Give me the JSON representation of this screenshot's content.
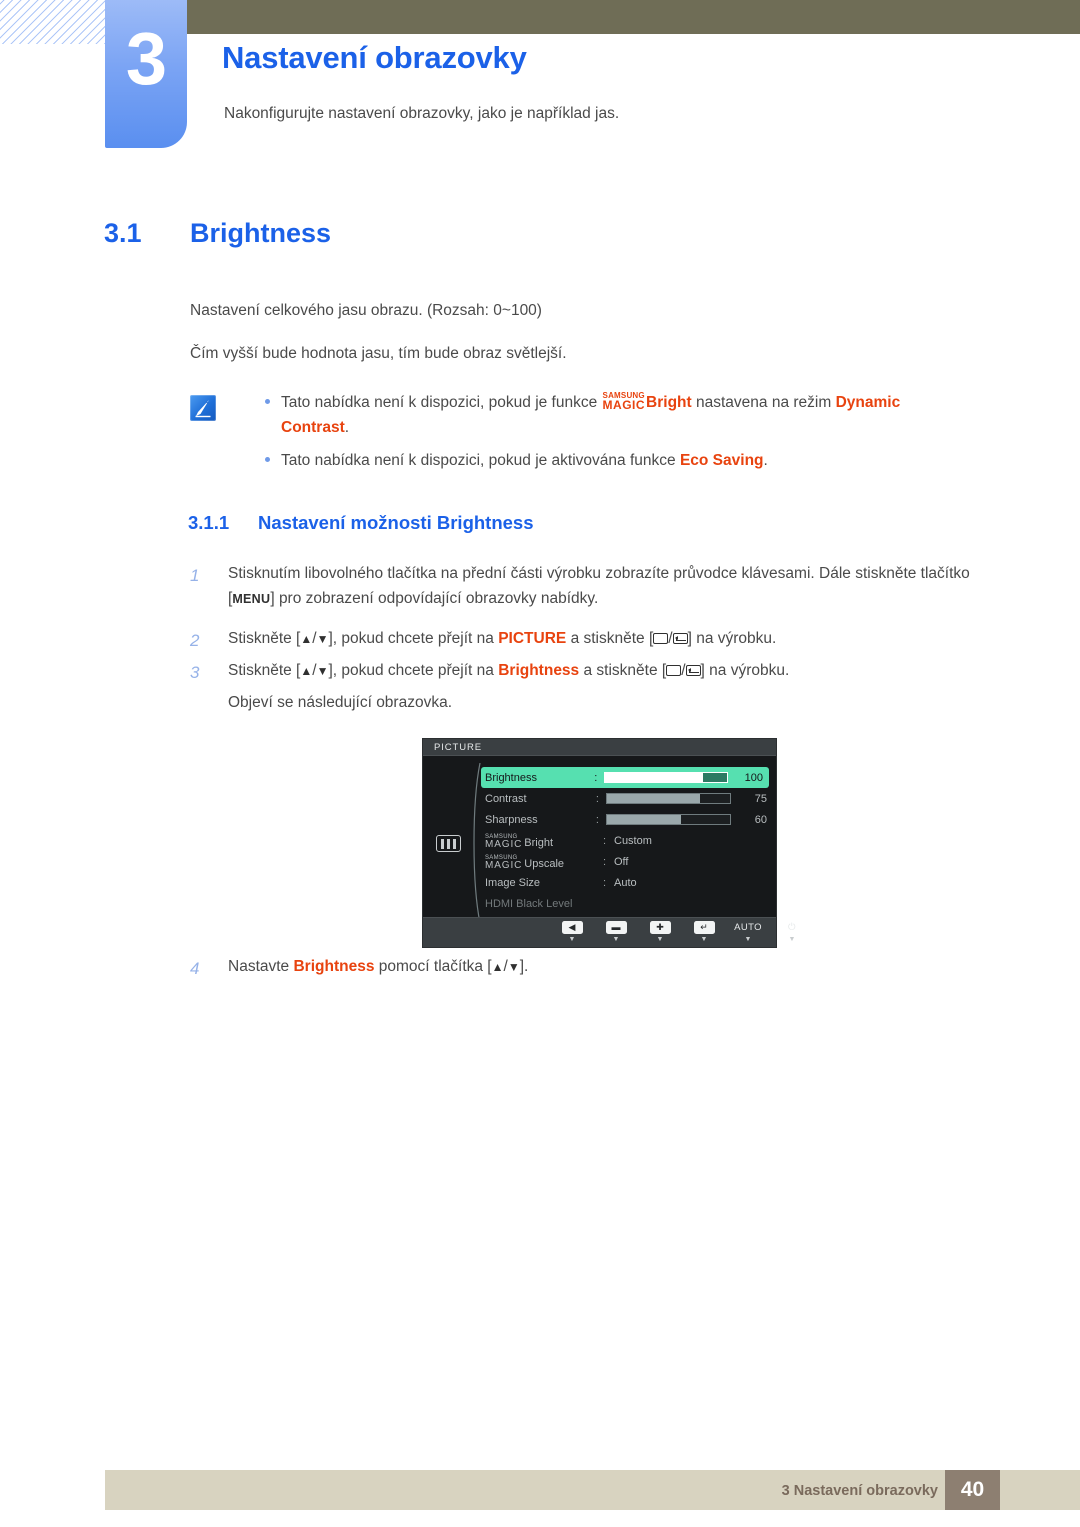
{
  "header": {
    "chapter_number": "3",
    "chapter_title": "Nastavení obrazovky",
    "chapter_subtitle": "Nakonfigurujte nastavení obrazovky, jako je například jas."
  },
  "section": {
    "number": "3.1",
    "title": "Brightness",
    "paragraph_1": "Nastavení celkového jasu obrazu. (Rozsah: 0~100)",
    "paragraph_2": "Čím vyšší bude hodnota jasu, tím bude obraz světlejší."
  },
  "note": {
    "icon": "note-pen-icon",
    "items": [
      {
        "text_before": "Tato nabídka není k dispozici, pokud je funkce",
        "magic_samsung": "SAMSUNG",
        "magic_magic": "MAGIC",
        "magic_suffix": "Bright",
        "text_middle": "nastavena na režim",
        "highlight": "Dynamic Contrast",
        "text_after": "."
      },
      {
        "text_before": "Tato nabídka není k dispozici, pokud je aktivována funkce",
        "highlight": "Eco Saving",
        "text_after": "."
      }
    ]
  },
  "subsection": {
    "number": "3.1.1",
    "title": "Nastavení možnosti Brightness"
  },
  "steps": [
    {
      "number": "1",
      "part_a": "Stisknutím libovolného tlačítka na přední části výrobku zobrazíte průvodce klávesami. Dále stiskněte tlačítko [",
      "keycap": "MENU",
      "part_b": "] pro zobrazení odpovídající obrazovky nabídky."
    },
    {
      "number": "2",
      "part_a": "Stiskněte [",
      "up": "▲",
      "sep": "/",
      "down": "▼",
      "part_b": "], pokud chcete přejít na",
      "highlight": "PICTURE",
      "part_c": "a stiskněte [",
      "part_d": "] na výrobku."
    },
    {
      "number": "3",
      "part_a": "Stiskněte [",
      "up": "▲",
      "sep": "/",
      "down": "▼",
      "part_b": "], pokud chcete přejít na",
      "highlight": "Brightness",
      "part_c": "a stiskněte [",
      "part_d": "] na výrobku.",
      "followup": "Objeví se následující obrazovka."
    },
    {
      "number": "4",
      "part_a": "Nastavte",
      "highlight": "Brightness",
      "part_b": "pomocí tlačítka [",
      "up": "▲",
      "sep": "/",
      "down": "▼",
      "part_c": "]."
    }
  ],
  "osd": {
    "title": "PICTURE",
    "left_icon": "picture-bars-icon",
    "rows": [
      {
        "label": "Brightness",
        "type": "bar",
        "value": "100",
        "fill_percent": 100,
        "selected": true
      },
      {
        "label": "Contrast",
        "type": "bar",
        "value": "75",
        "fill_percent": 75,
        "selected": false
      },
      {
        "label": "Sharpness",
        "type": "bar",
        "value": "60",
        "fill_percent": 60,
        "selected": false
      },
      {
        "label_samsung": "SAMSUNG",
        "label_magic": "MAGIC",
        "label_suffix": "Bright",
        "type": "text",
        "value": "Custom",
        "selected": false
      },
      {
        "label_samsung": "SAMSUNG",
        "label_magic": "MAGIC",
        "label_suffix": "Upscale",
        "type": "text",
        "value": "Off",
        "selected": false
      },
      {
        "label": "Image Size",
        "type": "text",
        "value": "Auto",
        "selected": false
      },
      {
        "label": "HDMI Black Level",
        "type": "text",
        "value": "",
        "selected": false,
        "dim": true
      }
    ],
    "scroll_indicator": "▼",
    "buttons": [
      {
        "name": "back-button",
        "glyph": "◀",
        "tick": "▼"
      },
      {
        "name": "minus-button",
        "glyph": "▬",
        "tick": "▼"
      },
      {
        "name": "plus-button",
        "glyph": "✚",
        "tick": "▼"
      },
      {
        "name": "enter-button",
        "glyph": "↵",
        "tick": "▼"
      },
      {
        "name": "auto-button",
        "text": "AUTO",
        "tick": "▼"
      },
      {
        "name": "power-button",
        "text": "⏻",
        "tick": "▼"
      }
    ]
  },
  "footer": {
    "text": "3 Nastavení obrazovky",
    "page": "40"
  },
  "colors": {
    "accent_blue": "#1b61e8",
    "highlight_orange": "#e8430f",
    "olive_bar": "#6f6d56",
    "footer_beige": "#d8d3c0",
    "footer_page_brown": "#8d7f71",
    "osd_selected_green": "#56e0b0"
  }
}
